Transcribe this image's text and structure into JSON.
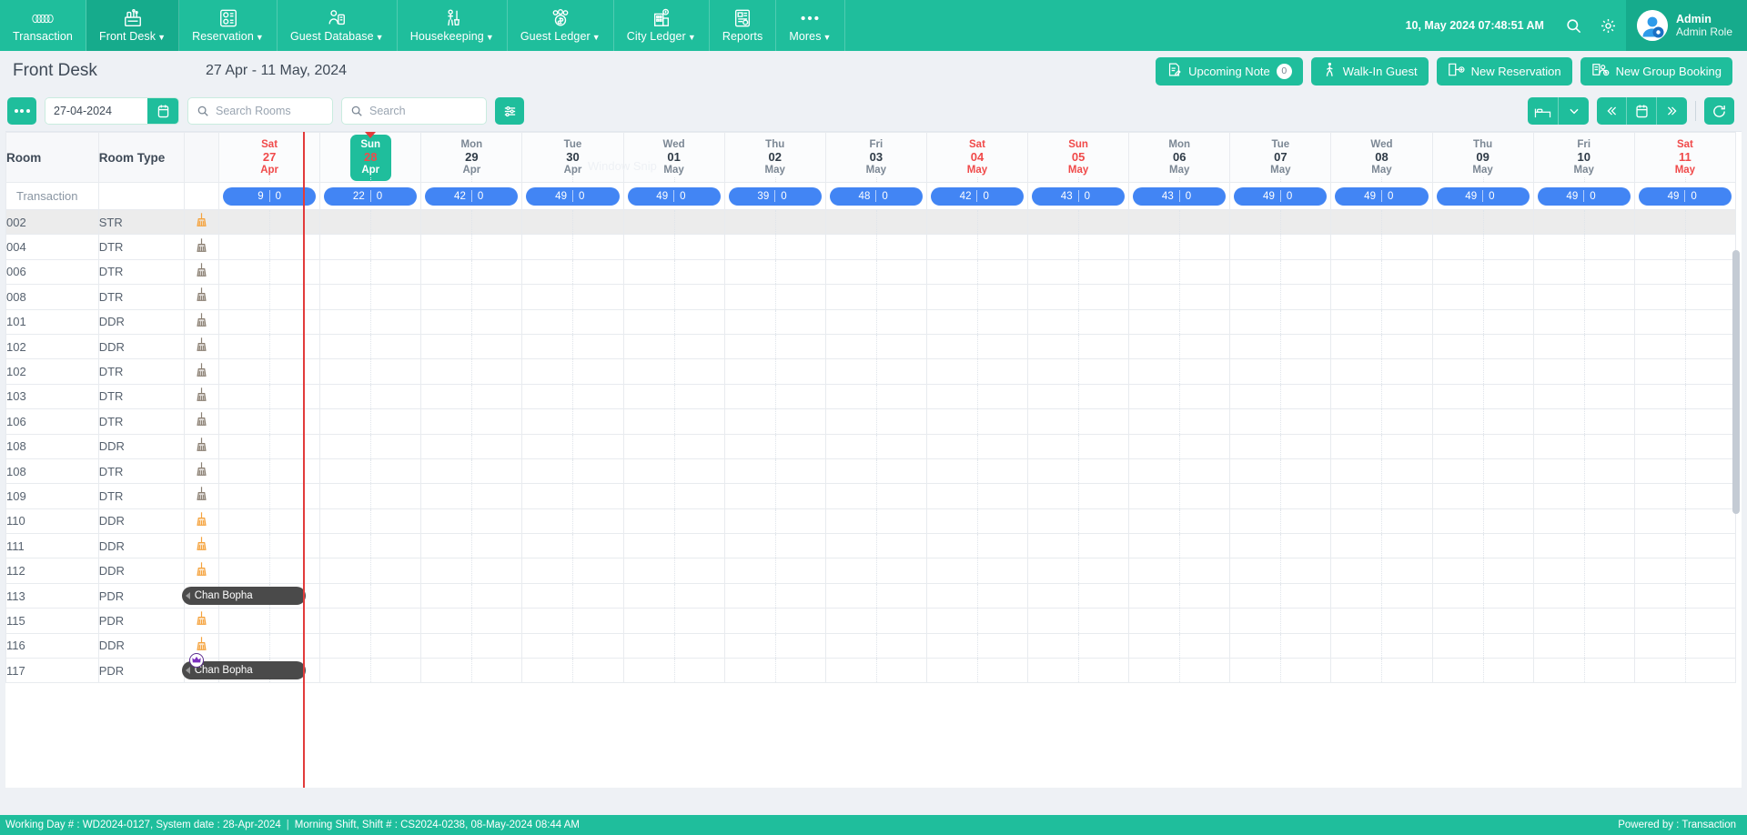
{
  "topnav": {
    "items": [
      {
        "label": "Transaction",
        "icon": "rings-icon",
        "caret": false,
        "active": false
      },
      {
        "label": "Front Desk",
        "icon": "front-desk-icon",
        "caret": true,
        "active": true
      },
      {
        "label": "Reservation",
        "icon": "reservation-icon",
        "caret": true,
        "active": false
      },
      {
        "label": "Guest Database",
        "icon": "guest-database-icon",
        "caret": true,
        "active": false
      },
      {
        "label": "Housekeeping",
        "icon": "housekeeping-icon",
        "caret": true,
        "active": false
      },
      {
        "label": "Guest Ledger",
        "icon": "guest-ledger-icon",
        "caret": true,
        "active": false
      },
      {
        "label": "City Ledger",
        "icon": "city-ledger-icon",
        "caret": true,
        "active": false
      },
      {
        "label": "Reports",
        "icon": "reports-icon",
        "caret": false,
        "active": false
      },
      {
        "label": "Mores",
        "icon": "more-dots-icon",
        "caret": true,
        "active": false
      }
    ],
    "clock": "10, May 2024 07:48:51 AM",
    "user_name": "Admin",
    "user_role": "Admin Role"
  },
  "page": {
    "title": "Front Desk",
    "date_range": "27 Apr - 11 May, 2024"
  },
  "head_actions": [
    {
      "label": "Upcoming Note",
      "icon": "note-icon",
      "count": "0"
    },
    {
      "label": "Walk-In Guest",
      "icon": "walking-person-icon"
    },
    {
      "label": "New Reservation",
      "icon": "new-reservation-icon"
    },
    {
      "label": "New Group Booking",
      "icon": "group-booking-icon"
    }
  ],
  "toolbar": {
    "date_value": "27-04-2024",
    "search_rooms_placeholder": "Search Rooms",
    "search_rooms_value": "",
    "search_placeholder": "Search",
    "search_value": ""
  },
  "grid": {
    "col_room": "Room",
    "col_room_type": "Room Type",
    "transaction_label": "Transaction",
    "days": [
      {
        "dow": "Sat",
        "num": "27",
        "mon": "Apr",
        "weekend": true,
        "today": false,
        "occupied": "9",
        "vacant": "0"
      },
      {
        "dow": "Sun",
        "num": "28",
        "mon": "Apr",
        "weekend": true,
        "today": true,
        "occupied": "22",
        "vacant": "0"
      },
      {
        "dow": "Mon",
        "num": "29",
        "mon": "Apr",
        "weekend": false,
        "today": false,
        "occupied": "42",
        "vacant": "0"
      },
      {
        "dow": "Tue",
        "num": "30",
        "mon": "Apr",
        "weekend": false,
        "today": false,
        "occupied": "49",
        "vacant": "0"
      },
      {
        "dow": "Wed",
        "num": "01",
        "mon": "May",
        "weekend": false,
        "today": false,
        "occupied": "49",
        "vacant": "0"
      },
      {
        "dow": "Thu",
        "num": "02",
        "mon": "May",
        "weekend": false,
        "today": false,
        "occupied": "39",
        "vacant": "0"
      },
      {
        "dow": "Fri",
        "num": "03",
        "mon": "May",
        "weekend": false,
        "today": false,
        "occupied": "48",
        "vacant": "0"
      },
      {
        "dow": "Sat",
        "num": "04",
        "mon": "May",
        "weekend": true,
        "today": false,
        "occupied": "42",
        "vacant": "0"
      },
      {
        "dow": "Sun",
        "num": "05",
        "mon": "May",
        "weekend": true,
        "today": false,
        "occupied": "43",
        "vacant": "0"
      },
      {
        "dow": "Mon",
        "num": "06",
        "mon": "May",
        "weekend": false,
        "today": false,
        "occupied": "43",
        "vacant": "0"
      },
      {
        "dow": "Tue",
        "num": "07",
        "mon": "May",
        "weekend": false,
        "today": false,
        "occupied": "49",
        "vacant": "0"
      },
      {
        "dow": "Wed",
        "num": "08",
        "mon": "May",
        "weekend": false,
        "today": false,
        "occupied": "49",
        "vacant": "0"
      },
      {
        "dow": "Thu",
        "num": "09",
        "mon": "May",
        "weekend": false,
        "today": false,
        "occupied": "49",
        "vacant": "0"
      },
      {
        "dow": "Fri",
        "num": "10",
        "mon": "May",
        "weekend": false,
        "today": false,
        "occupied": "49",
        "vacant": "0"
      },
      {
        "dow": "Sat",
        "num": "11",
        "mon": "May",
        "weekend": true,
        "today": false,
        "occupied": "49",
        "vacant": "0"
      }
    ],
    "rooms": [
      {
        "room": "002",
        "type": "STR",
        "status_icon": "broom-icon",
        "status_color": "#f5a23c",
        "highlight": true
      },
      {
        "room": "004",
        "type": "DTR",
        "status_icon": "broom-icon",
        "status_color": "#8a7f72",
        "highlight": false
      },
      {
        "room": "006",
        "type": "DTR",
        "status_icon": "broom-icon",
        "status_color": "#8a7f72",
        "highlight": false
      },
      {
        "room": "008",
        "type": "DTR",
        "status_icon": "broom-icon",
        "status_color": "#8a7f72",
        "highlight": false
      },
      {
        "room": "101",
        "type": "DDR",
        "status_icon": "broom-icon",
        "status_color": "#8a7f72",
        "highlight": false
      },
      {
        "room": "102",
        "type": "DDR",
        "status_icon": "broom-icon",
        "status_color": "#8a7f72",
        "highlight": false
      },
      {
        "room": "102",
        "type": "DTR",
        "status_icon": "broom-icon",
        "status_color": "#8a7f72",
        "highlight": false
      },
      {
        "room": "103",
        "type": "DTR",
        "status_icon": "broom-icon",
        "status_color": "#8a7f72",
        "highlight": false
      },
      {
        "room": "106",
        "type": "DTR",
        "status_icon": "broom-icon",
        "status_color": "#8a7f72",
        "highlight": false
      },
      {
        "room": "108",
        "type": "DDR",
        "status_icon": "broom-icon",
        "status_color": "#8a7f72",
        "highlight": false
      },
      {
        "room": "108",
        "type": "DTR",
        "status_icon": "broom-icon",
        "status_color": "#8a7f72",
        "highlight": false
      },
      {
        "room": "109",
        "type": "DTR",
        "status_icon": "broom-icon",
        "status_color": "#8a7f72",
        "highlight": false
      },
      {
        "room": "110",
        "type": "DDR",
        "status_icon": "broom-icon",
        "status_color": "#f5a23c",
        "highlight": false
      },
      {
        "room": "111",
        "type": "DDR",
        "status_icon": "broom-icon",
        "status_color": "#f5a23c",
        "highlight": false
      },
      {
        "room": "112",
        "type": "DDR",
        "status_icon": "broom-icon",
        "status_color": "#f5a23c",
        "highlight": false
      },
      {
        "room": "113",
        "type": "PDR",
        "status_icon": "broom-icon",
        "status_color": "#f5a23c",
        "highlight": false
      },
      {
        "room": "115",
        "type": "PDR",
        "status_icon": "broom-icon",
        "status_color": "#f5a23c",
        "highlight": false
      },
      {
        "room": "116",
        "type": "DDR",
        "status_icon": "broom-icon",
        "status_color": "#f5a23c",
        "highlight": false
      },
      {
        "room": "117",
        "type": "PDR",
        "status_icon": "broom-icon",
        "status_color": "#f5a23c",
        "highlight": false
      }
    ],
    "bookings": [
      {
        "guest": "Chan Bopha",
        "row_index": 15,
        "start_col": 0,
        "span_cols": 1.5,
        "vip": false
      },
      {
        "guest": "Chan Bopha",
        "row_index": 18,
        "start_col": 0,
        "span_cols": 1.5,
        "vip": true
      }
    ],
    "watermark": "Window Snip"
  },
  "footer": {
    "working_day": "Working Day # : WD2024-0127, System date : 28-Apr-2024",
    "shift": "Morning Shift, Shift # : CS2024-0238, 08-May-2024 08:44 AM",
    "powered_by": "Powered by : Transaction"
  },
  "colors": {
    "brand_teal": "#1fbe9c",
    "brand_teal_dark": "#16ab8c",
    "pill_blue": "#4285f4",
    "today_red": "#e23b3b",
    "booking_grey": "#4a4a4a"
  }
}
